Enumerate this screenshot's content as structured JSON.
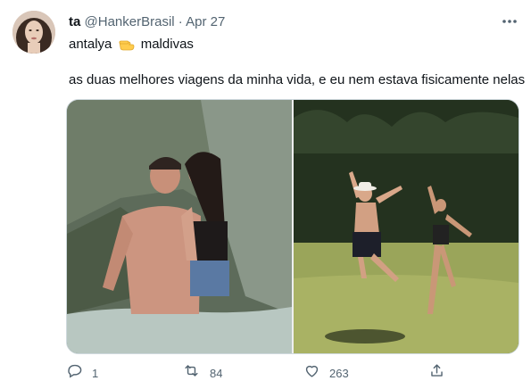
{
  "tweet": {
    "display_name": "ta",
    "handle": "@HankerBrasil",
    "separator": "·",
    "date": "Apr 27",
    "text_line1_a": "antalya",
    "text_line1_b": "maldivas",
    "text_line2": "as duas melhores viagens da minha vida, e eu nem estava fisicamente nelas"
  },
  "actions": {
    "reply_count": "1",
    "retweet_count": "84",
    "like_count": "263"
  },
  "icons": {
    "more": "more-dots-icon",
    "emoji": "pointing-hand-emoji-icon",
    "reply": "reply-icon",
    "retweet": "retweet-icon",
    "like": "heart-icon",
    "share": "share-icon"
  },
  "colors": {
    "text": "#0f1419",
    "secondary": "#536471",
    "border": "#cfd9de"
  }
}
